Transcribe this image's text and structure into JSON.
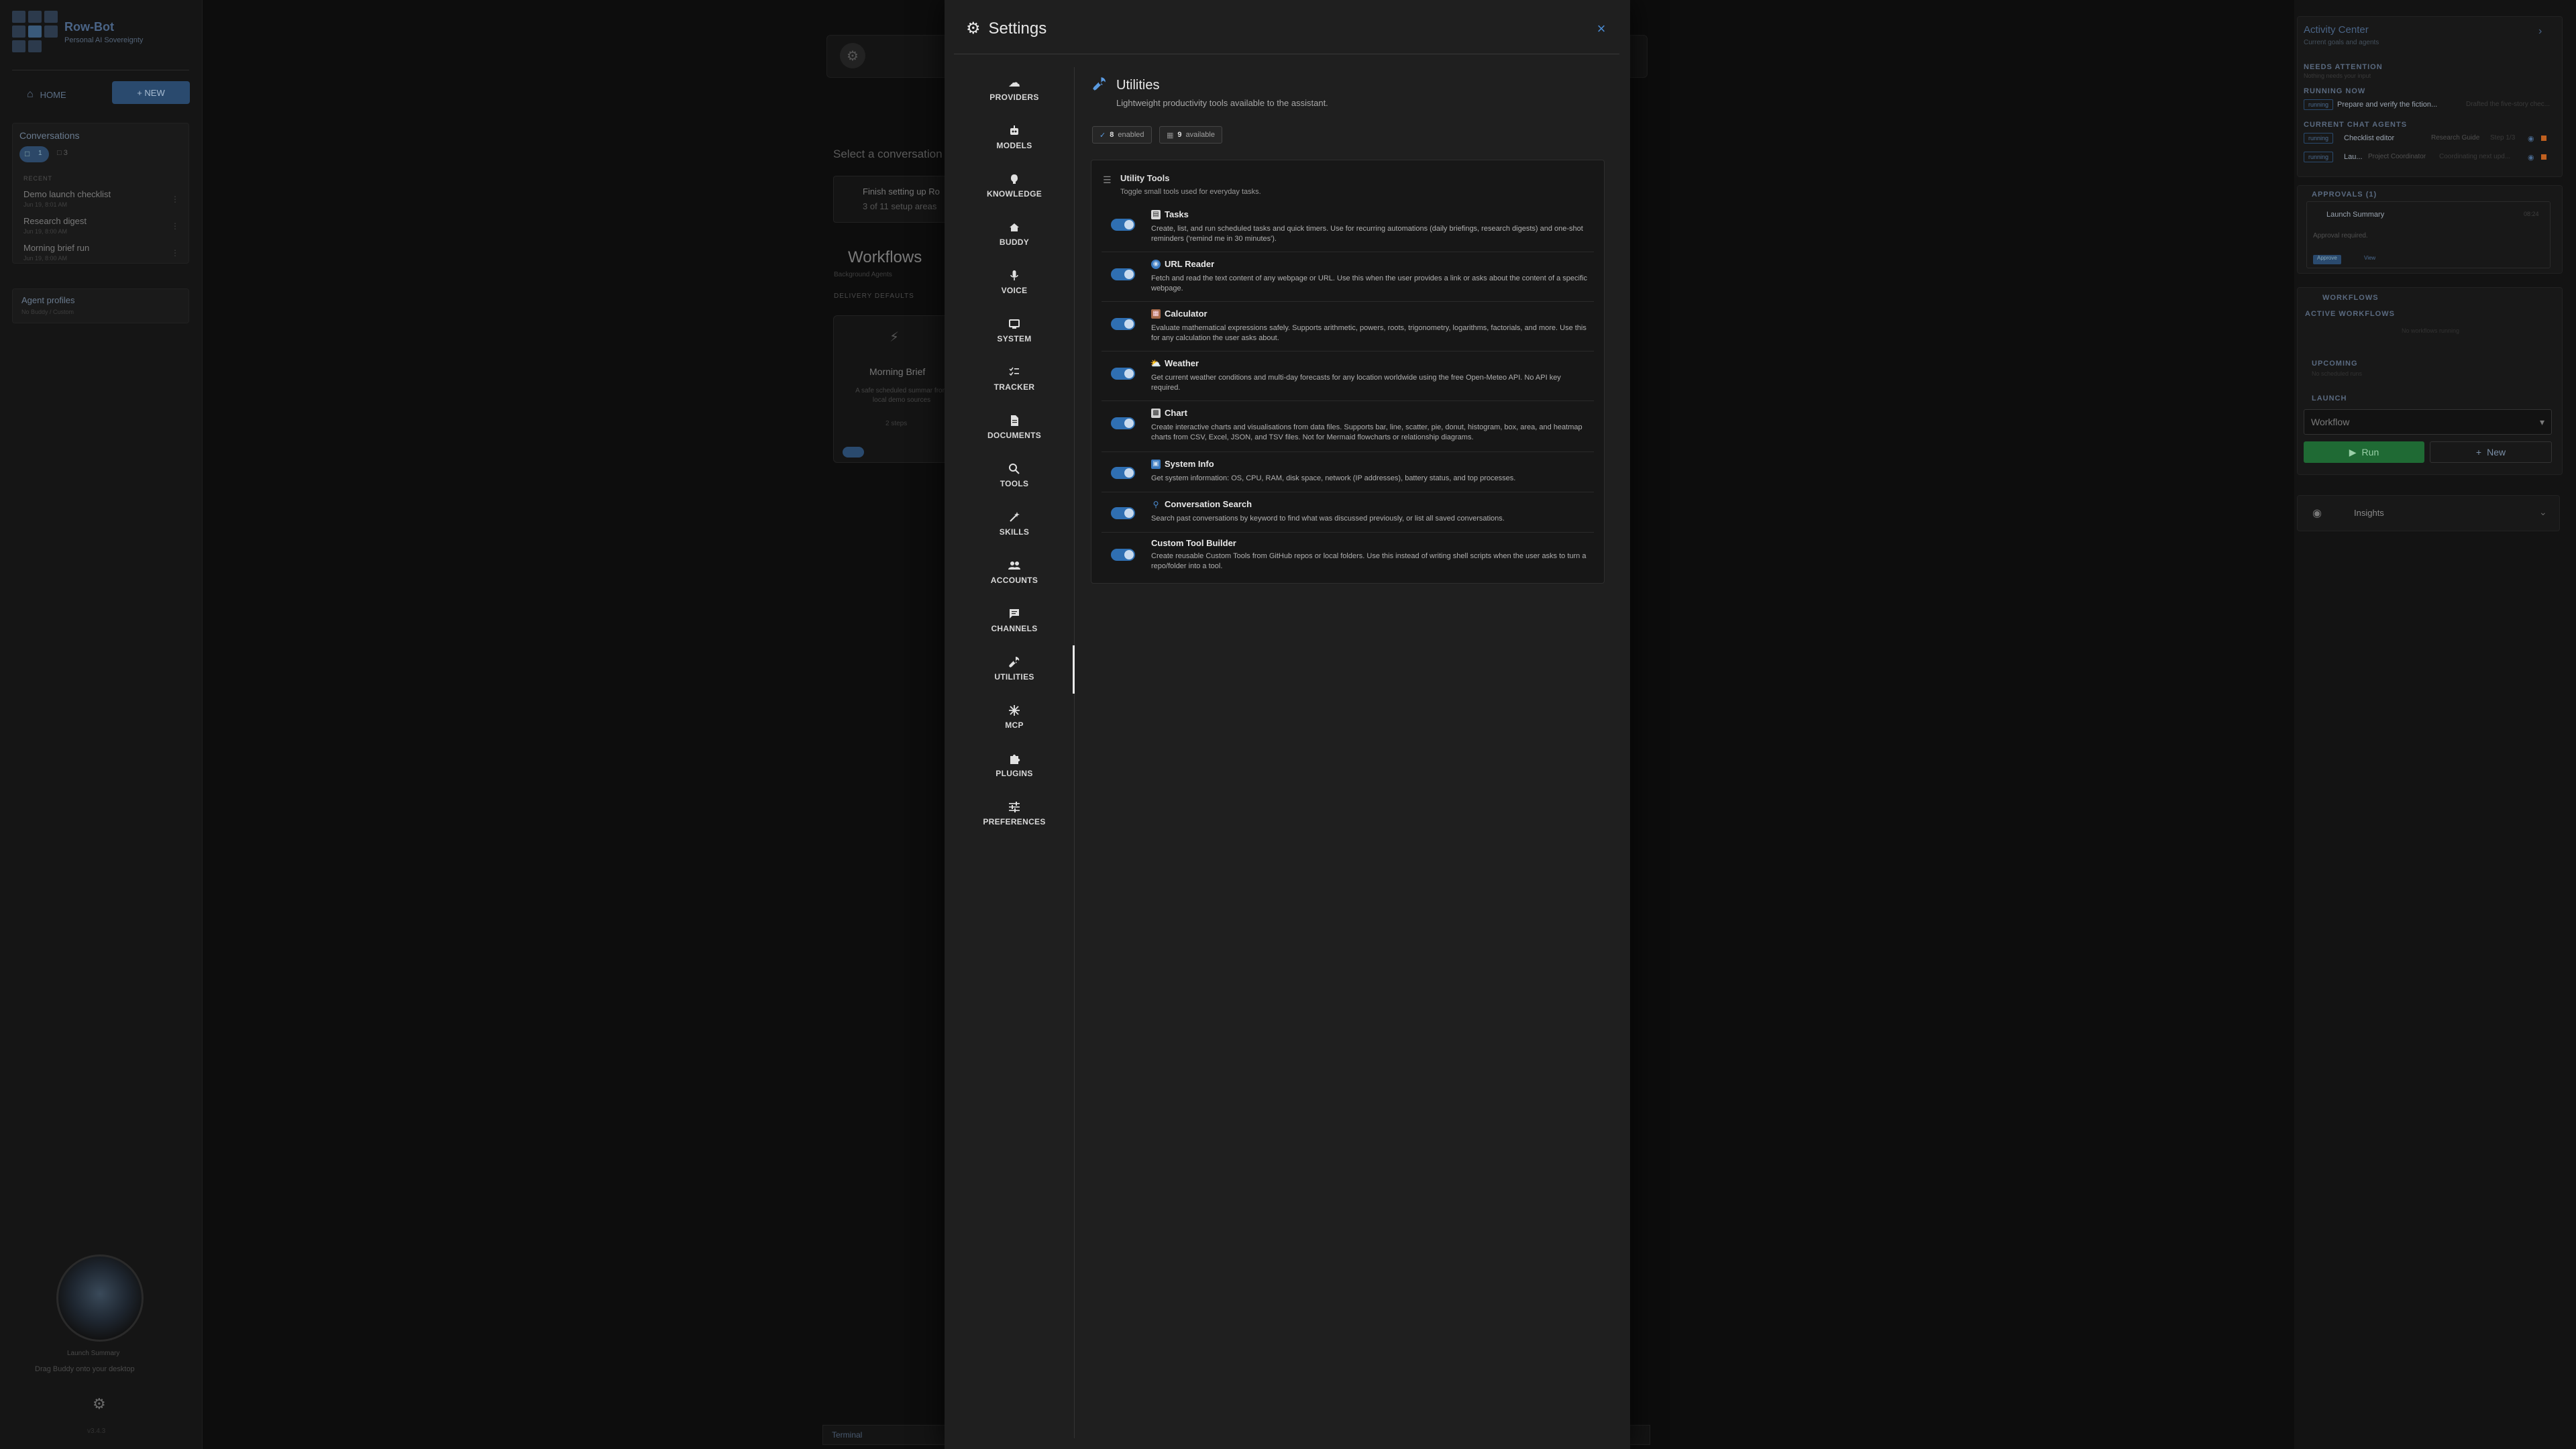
{
  "left_sidebar": {
    "app_title": "Row-Bot",
    "app_subtitle": "Personal AI Sovereignty",
    "home_label": "HOME",
    "new_label": "+ NEW",
    "conversations_title": "Conversations",
    "conv_chip_count": "1",
    "conv_chip2_count": "3",
    "recent_label": "RECENT",
    "conversations": [
      {
        "title": "Demo launch checklist",
        "date": "Jun 19, 8:01 AM"
      },
      {
        "title": "Research digest",
        "date": "Jun 19, 8:00 AM"
      },
      {
        "title": "Morning brief run",
        "date": "Jun 19, 8:00 AM"
      }
    ],
    "agent_profiles_title": "Agent profiles",
    "agent_profiles_sub": "No Buddy / Custom",
    "buddy_caption": "Launch Summary",
    "buddy_drag": "Drag Buddy onto your desktop",
    "version": "v3.4.3"
  },
  "center": {
    "select_conversation": "Select a conversation",
    "setup_title": "Finish setting up Ro",
    "setup_progress": "3 of 11 setup areas",
    "workflows_title": "Workflows",
    "workflows_sub": "Background Agents",
    "delivery_defaults": "DELIVERY DEFAULTS",
    "morning_card_title": "Morning Brief",
    "morning_card_desc": "A safe scheduled summar from local demo sources",
    "morning_card_steps": "2 steps",
    "terminal_label": "Terminal"
  },
  "right_sidebar": {
    "activity_title": "Activity Center",
    "activity_sub": "Current goals and agents",
    "needs_attention": "NEEDS ATTENTION",
    "needs_attention_sub": "Nothing needs your input",
    "running_now": "RUNNING NOW",
    "running_chip": "running",
    "running_text": "Prepare and verify the fiction...",
    "running_detail": "Drafted the five-story chec...",
    "current_agents": "CURRENT CHAT AGENTS",
    "agents": [
      {
        "chip": "running",
        "name": "Checklist editor",
        "role": "Research Guide",
        "status": "Step 1/3"
      },
      {
        "chip": "running",
        "name": "Lau...",
        "role": "Project Coordinator",
        "status": "Coordinating next upd..."
      }
    ],
    "approvals_title": "APPROVALS (1)",
    "approval_item": "Launch Summary",
    "approval_time": "08:24",
    "approval_required": "Approval required.",
    "approve_label": "Approve",
    "view_label": "View",
    "workflows_title": "WORKFLOWS",
    "active_workflows": "ACTIVE WORKFLOWS",
    "no_active": "No workflows running",
    "upcoming": "UPCOMING",
    "upcoming_sub": "No scheduled runs",
    "launch": "LAUNCH",
    "workflow_select": "Workflow",
    "run_label": "Run",
    "new_label": "New",
    "insights_label": "Insights"
  },
  "settings": {
    "title": "Settings",
    "close_label": "×",
    "nav": [
      {
        "label": "PROVIDERS",
        "icon": "cloud-icon"
      },
      {
        "label": "MODELS",
        "icon": "robot-icon"
      },
      {
        "label": "KNOWLEDGE",
        "icon": "brain-icon"
      },
      {
        "label": "BUDDY",
        "icon": "buddy-icon"
      },
      {
        "label": "VOICE",
        "icon": "microphone-icon"
      },
      {
        "label": "SYSTEM",
        "icon": "monitor-icon"
      },
      {
        "label": "TRACKER",
        "icon": "checklist-icon"
      },
      {
        "label": "DOCUMENTS",
        "icon": "document-icon"
      },
      {
        "label": "TOOLS",
        "icon": "search-icon"
      },
      {
        "label": "SKILLS",
        "icon": "wand-icon"
      },
      {
        "label": "ACCOUNTS",
        "icon": "people-icon"
      },
      {
        "label": "CHANNELS",
        "icon": "chat-icon"
      },
      {
        "label": "UTILITIES",
        "icon": "wrench-icon"
      },
      {
        "label": "MCP",
        "icon": "hub-icon"
      },
      {
        "label": "PLUGINS",
        "icon": "puzzle-icon"
      },
      {
        "label": "PREFERENCES",
        "icon": "sliders-icon"
      }
    ],
    "content": {
      "title": "Utilities",
      "subtitle": "Lightweight productivity tools available to the assistant.",
      "enabled_count": "8",
      "enabled_label": "enabled",
      "available_count": "9",
      "available_label": "available",
      "card_title": "Utility Tools",
      "card_subtitle": "Toggle small tools used for everyday tasks.",
      "tools": [
        {
          "name": "Tasks",
          "icon": "clipboard-icon",
          "color": "#9aa4b0",
          "enabled": true,
          "desc": "Create, list, and run scheduled tasks and quick timers. Use for recurring automations (daily briefings, research digests) and one-shot reminders ('remind me in 30 minutes')."
        },
        {
          "name": "URL Reader",
          "icon": "globe-icon",
          "color": "#4a8ad0",
          "enabled": true,
          "desc": "Fetch and read the text content of any webpage or URL. Use this when the user provides a link or asks about the content of a specific webpage."
        },
        {
          "name": "Calculator",
          "icon": "calculator-icon",
          "color": "#b07a5a",
          "enabled": true,
          "desc": "Evaluate mathematical expressions safely. Supports arithmetic, powers, roots, trigonometry, logarithms, factorials, and more. Use this for any calculation the user asks about."
        },
        {
          "name": "Weather",
          "icon": "sun-cloud-icon",
          "color": "#e0a030",
          "enabled": true,
          "desc": "Get current weather conditions and multi-day forecasts for any location worldwide using the free Open-Meteo API. No API key required."
        },
        {
          "name": "Chart",
          "icon": "bar-chart-icon",
          "color": "#a0a8b0",
          "enabled": true,
          "desc": "Create interactive charts and visualisations from data files. Supports bar, line, scatter, pie, donut, histogram, box, area, and heatmap charts from CSV, Excel, JSON, and TSV files. Not for Mermaid flowcharts or relationship diagrams."
        },
        {
          "name": "System Info",
          "icon": "computer-icon",
          "color": "#4a8ad0",
          "enabled": true,
          "desc": "Get system information: OS, CPU, RAM, disk space, network (IP addresses), battery status, and top processes."
        },
        {
          "name": "Conversation Search",
          "icon": "magnifier-icon",
          "color": "#4a8ad0",
          "enabled": true,
          "desc": "Search past conversations by keyword to find what was discussed previously, or list all saved conversations."
        },
        {
          "name": "Custom Tool Builder",
          "icon": "",
          "color": "#888",
          "enabled": true,
          "desc": "Create reusable Custom Tools from GitHub repos or local folders. Use this instead of writing shell scripts when the user asks to turn a repo/folder into a tool."
        }
      ]
    }
  }
}
